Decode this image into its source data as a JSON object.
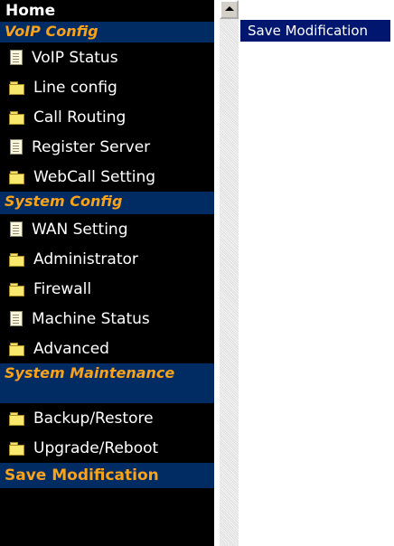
{
  "nav": {
    "home": "Home",
    "sections": [
      {
        "title": "VoIP Config",
        "items": [
          {
            "label": "VoIP Status",
            "icon": "document-icon"
          },
          {
            "label": "Line config",
            "icon": "folder-icon"
          },
          {
            "label": "Call Routing",
            "icon": "folder-icon"
          },
          {
            "label": "Register Server",
            "icon": "document-icon"
          },
          {
            "label": "WebCall Setting",
            "icon": "folder-icon"
          }
        ]
      },
      {
        "title": "System Config",
        "items": [
          {
            "label": "WAN Setting",
            "icon": "document-icon"
          },
          {
            "label": "Administrator",
            "icon": "folder-icon"
          },
          {
            "label": "Firewall",
            "icon": "folder-icon"
          },
          {
            "label": "Machine Status",
            "icon": "document-icon"
          },
          {
            "label": "Advanced",
            "icon": "folder-icon"
          }
        ]
      },
      {
        "title": "System Maintenance",
        "items": [
          {
            "label": "Backup/Restore",
            "icon": "folder-icon"
          },
          {
            "label": "Upgrade/Reboot",
            "icon": "folder-icon"
          }
        ]
      }
    ],
    "save": "Save Modification"
  },
  "main": {
    "save_button": "Save Modification"
  },
  "colors": {
    "nav_bg": "#000000",
    "section_bg": "#002b63",
    "section_text": "#f9a21a",
    "button_bg": "#00166f"
  }
}
